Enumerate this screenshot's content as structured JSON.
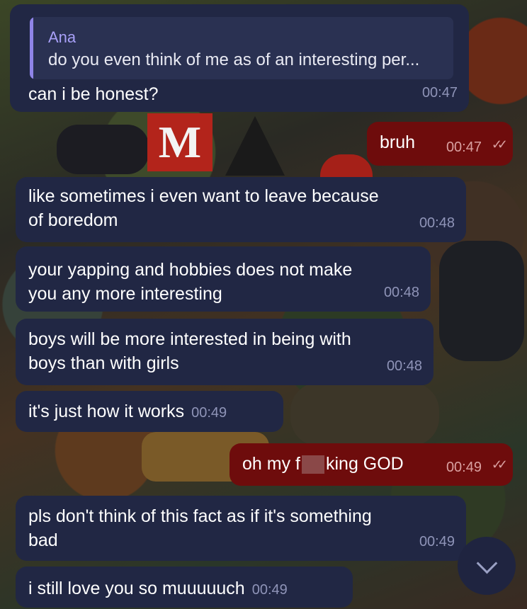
{
  "chat": {
    "messages": [
      {
        "side": "in",
        "reply_to": {
          "name": "Ana",
          "text": "do you even think of me as of an interesting per..."
        },
        "text": "can i be honest?",
        "time": "00:47"
      },
      {
        "side": "out",
        "text": "bruh",
        "time": "00:47",
        "status": "read"
      },
      {
        "side": "in",
        "lines": [
          "like sometimes i even want to leave because",
          "of boredom"
        ],
        "time": "00:48"
      },
      {
        "side": "in",
        "lines": [
          "your yapping and hobbies does not make",
          "you any more interesting"
        ],
        "time": "00:48"
      },
      {
        "side": "in",
        "lines": [
          "boys will be more interested in being with",
          "boys than with girls"
        ],
        "time": "00:48"
      },
      {
        "side": "in",
        "text": "it's just how it works",
        "time": "00:49"
      },
      {
        "side": "out",
        "text_before": "oh my f",
        "text_after": "king GOD",
        "time": "00:49",
        "status": "read"
      },
      {
        "side": "in",
        "lines": [
          "pls don't think of this fact as if it's something",
          "bad"
        ],
        "time": "00:49"
      },
      {
        "side": "in",
        "text": "i still love you so muuuuuch",
        "time": "00:49"
      }
    ]
  },
  "colors": {
    "incoming_bubble": "#212744",
    "outgoing_bubble": "#6e0c0c",
    "reply_accent": "#8f84e8"
  },
  "wallpaper": {
    "letter": "M"
  },
  "icons": {
    "read_status": "double-check-icon",
    "scroll_down": "chevron-down-icon"
  }
}
